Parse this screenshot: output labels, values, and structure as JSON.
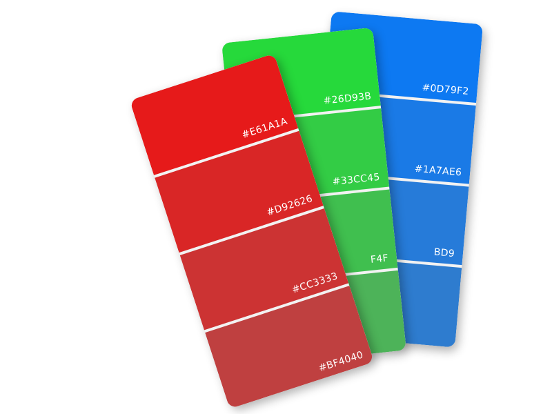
{
  "swatches": [
    {
      "name": "blue",
      "chips": [
        {
          "hex": "#0D79F2",
          "label": "#0D79F2"
        },
        {
          "hex": "#1A7AE6",
          "label": "#1A7AE6"
        },
        {
          "hex": "#267BD9",
          "label": "BD9"
        },
        {
          "hex": "#2E7CCF",
          "label": ""
        }
      ]
    },
    {
      "name": "green",
      "chips": [
        {
          "hex": "#26D93B",
          "label": "#26D93B"
        },
        {
          "hex": "#33CC45",
          "label": "#33CC45"
        },
        {
          "hex": "#40BF4F",
          "label": "F4F"
        },
        {
          "hex": "#4DB359",
          "label": ""
        }
      ]
    },
    {
      "name": "red",
      "chips": [
        {
          "hex": "#E61A1A",
          "label": "#E61A1A"
        },
        {
          "hex": "#D92626",
          "label": "#D92626"
        },
        {
          "hex": "#CC3333",
          "label": "#CC3333"
        },
        {
          "hex": "#BF4040",
          "label": "#BF4040"
        }
      ]
    }
  ]
}
